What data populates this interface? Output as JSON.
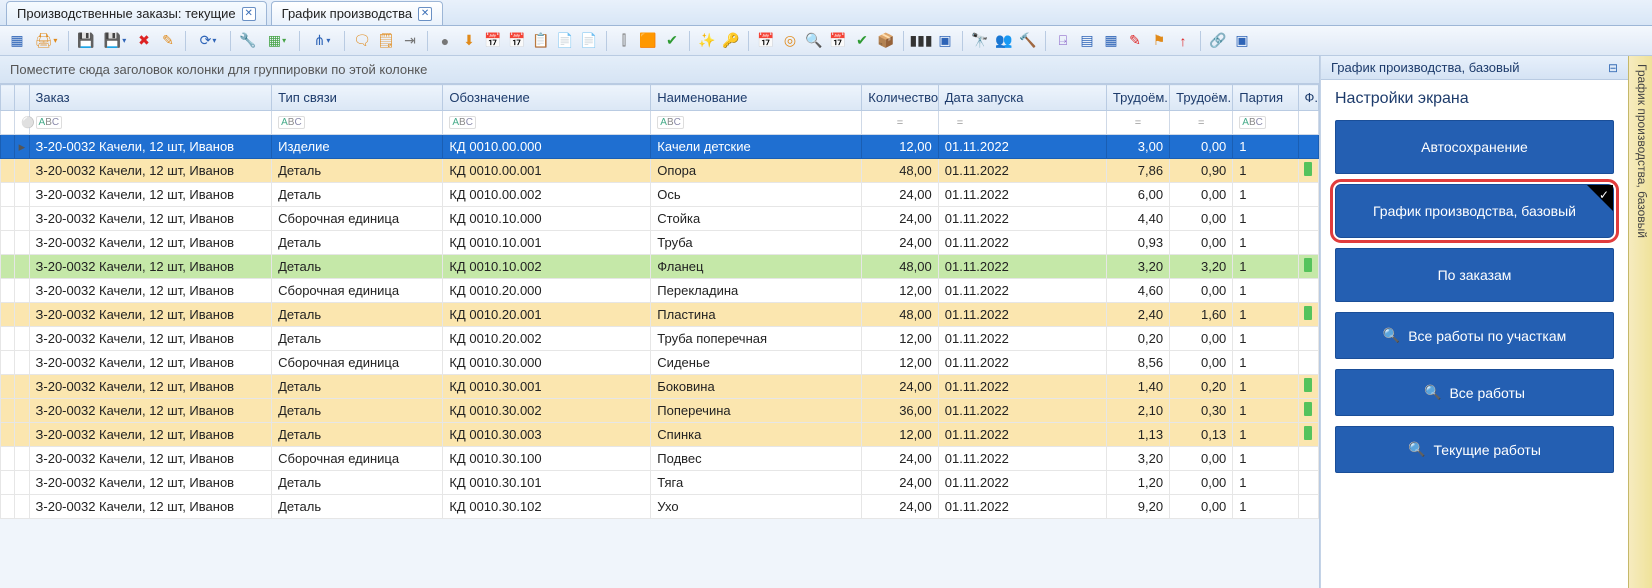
{
  "tabs": [
    {
      "label": "Производственные заказы: текущие",
      "active": false
    },
    {
      "label": "График производства",
      "active": true
    }
  ],
  "group_panel_hint": "Поместите сюда заголовок колонки для группировки по этой колонке",
  "columns": {
    "order": "Заказ",
    "link_type": "Тип связи",
    "designation": "Обозначение",
    "name": "Наименование",
    "qty": "Количество",
    "start_date": "Дата запуска",
    "labor1": "Трудоём...",
    "labor2": "Трудоём...",
    "batch": "Партия",
    "flag": "Ф..."
  },
  "filter_eq": "=",
  "rows": [
    {
      "style": "blue",
      "sel": true,
      "order": "З-20-0032 Качели, 12 шт, Иванов",
      "link": "Изделие",
      "des": "КД 0010.00.000",
      "name": "Качели детские",
      "qty": "12,00",
      "date": "01.11.2022",
      "l1": "3,00",
      "l2": "0,00",
      "batch": "1",
      "flag": false
    },
    {
      "style": "yellow",
      "order": "З-20-0032 Качели, 12 шт, Иванов",
      "link": "Деталь",
      "des": "КД 0010.00.001",
      "name": "Опора",
      "qty": "48,00",
      "date": "01.11.2022",
      "l1": "7,86",
      "l2": "0,90",
      "batch": "1",
      "flag": true
    },
    {
      "style": "white",
      "order": "З-20-0032 Качели, 12 шт, Иванов",
      "link": "Деталь",
      "des": "КД 0010.00.002",
      "name": "Ось",
      "qty": "24,00",
      "date": "01.11.2022",
      "l1": "6,00",
      "l2": "0,00",
      "batch": "1",
      "flag": false
    },
    {
      "style": "white",
      "order": "З-20-0032 Качели, 12 шт, Иванов",
      "link": "Сборочная единица",
      "des": "КД 0010.10.000",
      "name": "Стойка",
      "qty": "24,00",
      "date": "01.11.2022",
      "l1": "4,40",
      "l2": "0,00",
      "batch": "1",
      "flag": false
    },
    {
      "style": "white",
      "order": "З-20-0032 Качели, 12 шт, Иванов",
      "link": "Деталь",
      "des": "КД 0010.10.001",
      "name": "Труба",
      "qty": "24,00",
      "date": "01.11.2022",
      "l1": "0,93",
      "l2": "0,00",
      "batch": "1",
      "flag": false
    },
    {
      "style": "green",
      "order": "З-20-0032 Качели, 12 шт, Иванов",
      "link": "Деталь",
      "des": "КД 0010.10.002",
      "name": "Фланец",
      "qty": "48,00",
      "date": "01.11.2022",
      "l1": "3,20",
      "l2": "3,20",
      "batch": "1",
      "flag": true
    },
    {
      "style": "white",
      "order": "З-20-0032 Качели, 12 шт, Иванов",
      "link": "Сборочная единица",
      "des": "КД 0010.20.000",
      "name": "Перекладина",
      "qty": "12,00",
      "date": "01.11.2022",
      "l1": "4,60",
      "l2": "0,00",
      "batch": "1",
      "flag": false
    },
    {
      "style": "yellow",
      "order": "З-20-0032 Качели, 12 шт, Иванов",
      "link": "Деталь",
      "des": "КД 0010.20.001",
      "name": "Пластина",
      "qty": "48,00",
      "date": "01.11.2022",
      "l1": "2,40",
      "l2": "1,60",
      "batch": "1",
      "flag": true
    },
    {
      "style": "white",
      "order": "З-20-0032 Качели, 12 шт, Иванов",
      "link": "Деталь",
      "des": "КД 0010.20.002",
      "name": "Труба поперечная",
      "qty": "12,00",
      "date": "01.11.2022",
      "l1": "0,20",
      "l2": "0,00",
      "batch": "1",
      "flag": false
    },
    {
      "style": "white",
      "order": "З-20-0032 Качели, 12 шт, Иванов",
      "link": "Сборочная единица",
      "des": "КД 0010.30.000",
      "name": "Сиденье",
      "qty": "12,00",
      "date": "01.11.2022",
      "l1": "8,56",
      "l2": "0,00",
      "batch": "1",
      "flag": false
    },
    {
      "style": "yellow",
      "order": "З-20-0032 Качели, 12 шт, Иванов",
      "link": "Деталь",
      "des": "КД 0010.30.001",
      "name": "Боковина",
      "qty": "24,00",
      "date": "01.11.2022",
      "l1": "1,40",
      "l2": "0,20",
      "batch": "1",
      "flag": true
    },
    {
      "style": "yellow",
      "order": "З-20-0032 Качели, 12 шт, Иванов",
      "link": "Деталь",
      "des": "КД 0010.30.002",
      "name": "Поперечина",
      "qty": "36,00",
      "date": "01.11.2022",
      "l1": "2,10",
      "l2": "0,30",
      "batch": "1",
      "flag": true
    },
    {
      "style": "yellow",
      "order": "З-20-0032 Качели, 12 шт, Иванов",
      "link": "Деталь",
      "des": "КД 0010.30.003",
      "name": "Спинка",
      "qty": "12,00",
      "date": "01.11.2022",
      "l1": "1,13",
      "l2": "0,13",
      "batch": "1",
      "flag": true
    },
    {
      "style": "white",
      "order": "З-20-0032 Качели, 12 шт, Иванов",
      "link": "Сборочная единица",
      "des": "КД 0010.30.100",
      "name": "Подвес",
      "qty": "24,00",
      "date": "01.11.2022",
      "l1": "3,20",
      "l2": "0,00",
      "batch": "1",
      "flag": false
    },
    {
      "style": "white",
      "order": "З-20-0032 Качели, 12 шт, Иванов",
      "link": "Деталь",
      "des": "КД 0010.30.101",
      "name": "Тяга",
      "qty": "24,00",
      "date": "01.11.2022",
      "l1": "1,20",
      "l2": "0,00",
      "batch": "1",
      "flag": false
    },
    {
      "style": "white",
      "order": "З-20-0032 Качели, 12 шт, Иванов",
      "link": "Деталь",
      "des": "КД 0010.30.102",
      "name": "Ухо",
      "qty": "24,00",
      "date": "01.11.2022",
      "l1": "9,20",
      "l2": "0,00",
      "batch": "1",
      "flag": false
    }
  ],
  "side": {
    "header": "График производства, базовый",
    "title": "Настройки экрана",
    "btn_autosave": "Автосохранение",
    "btn_base": "График производства, базовый",
    "btn_orders": "По заказам",
    "btn_all_areas": "Все работы по участкам",
    "btn_all_works": "Все работы",
    "btn_current": "Текущие работы"
  },
  "side_tab_label": "График производства, базовый"
}
